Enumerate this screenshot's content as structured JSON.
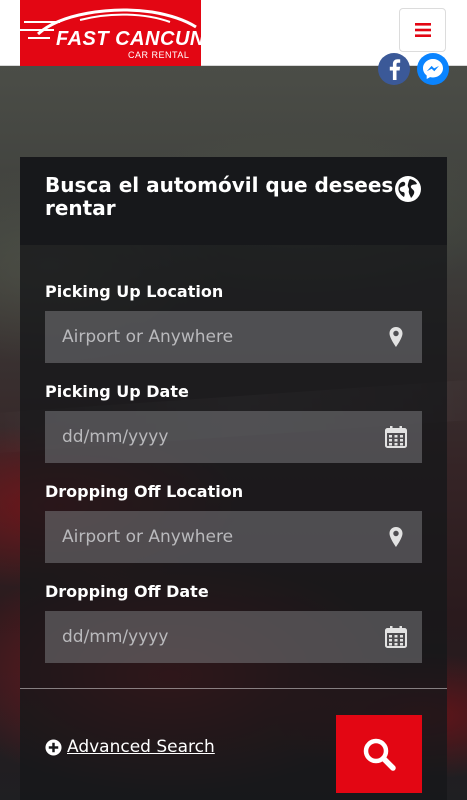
{
  "header": {
    "logo_main": "FAST CANCUN",
    "logo_sub": "CAR RENTAL",
    "menu_icon": "hamburger-menu-icon"
  },
  "social": {
    "facebook_icon": "facebook-icon",
    "messenger_icon": "messenger-icon"
  },
  "search": {
    "title": "Busca el automóvil que desees rentar",
    "title_icon": "globe-icon",
    "fields": [
      {
        "label": "Picking Up Location",
        "placeholder": "Airport or Anywhere",
        "value": "",
        "icon": "map-pin-icon"
      },
      {
        "label": "Picking Up Date",
        "placeholder": "dd/mm/yyyy",
        "value": "",
        "icon": "calendar-icon"
      },
      {
        "label": "Dropping Off Location",
        "placeholder": "Airport or Anywhere",
        "value": "",
        "icon": "map-pin-icon"
      },
      {
        "label": "Dropping Off Date",
        "placeholder": "dd/mm/yyyy",
        "value": "",
        "icon": "calendar-icon"
      }
    ],
    "advanced_label": "Advanced Search",
    "advanced_icon": "plus-circle-icon",
    "submit_icon": "search-icon"
  },
  "colors": {
    "brand_red": "#e30613",
    "panel_bg": "#17181b",
    "facebook": "#3b5998",
    "messenger": "#0a84ff"
  }
}
